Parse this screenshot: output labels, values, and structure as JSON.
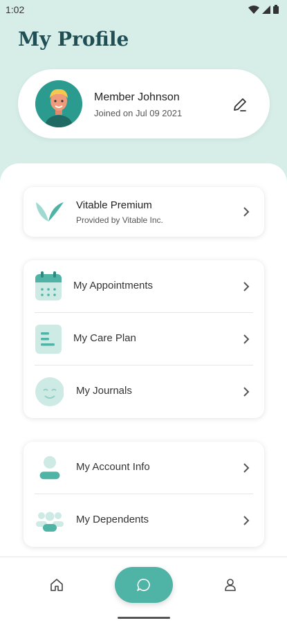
{
  "status_bar": {
    "time": "1:02",
    "icons": [
      "wifi-icon",
      "signal-icon",
      "battery-icon"
    ]
  },
  "page": {
    "title": "My Profile"
  },
  "profile": {
    "name": "Member Johnson",
    "joined": "Joined on Jul 09 2021",
    "edit_icon": "pencil-icon"
  },
  "premium": {
    "title": "Vitable Premium",
    "subtitle": "Provided by Vitable Inc."
  },
  "menu_group_1": [
    {
      "label": "My Appointments",
      "icon": "calendar-icon"
    },
    {
      "label": "My Care Plan",
      "icon": "document-icon"
    },
    {
      "label": "My Journals",
      "icon": "smiley-icon"
    }
  ],
  "menu_group_2": [
    {
      "label": "My Account Info",
      "icon": "user-icon"
    },
    {
      "label": "My Dependents",
      "icon": "group-icon"
    }
  ],
  "nav": {
    "items": [
      "home-icon",
      "chat-icon",
      "profile-icon"
    ]
  },
  "colors": {
    "accent": "#4fb3a5",
    "header_bg": "#d7eee8",
    "title": "#1f4f55",
    "icon_tint": "#cdeae4"
  }
}
